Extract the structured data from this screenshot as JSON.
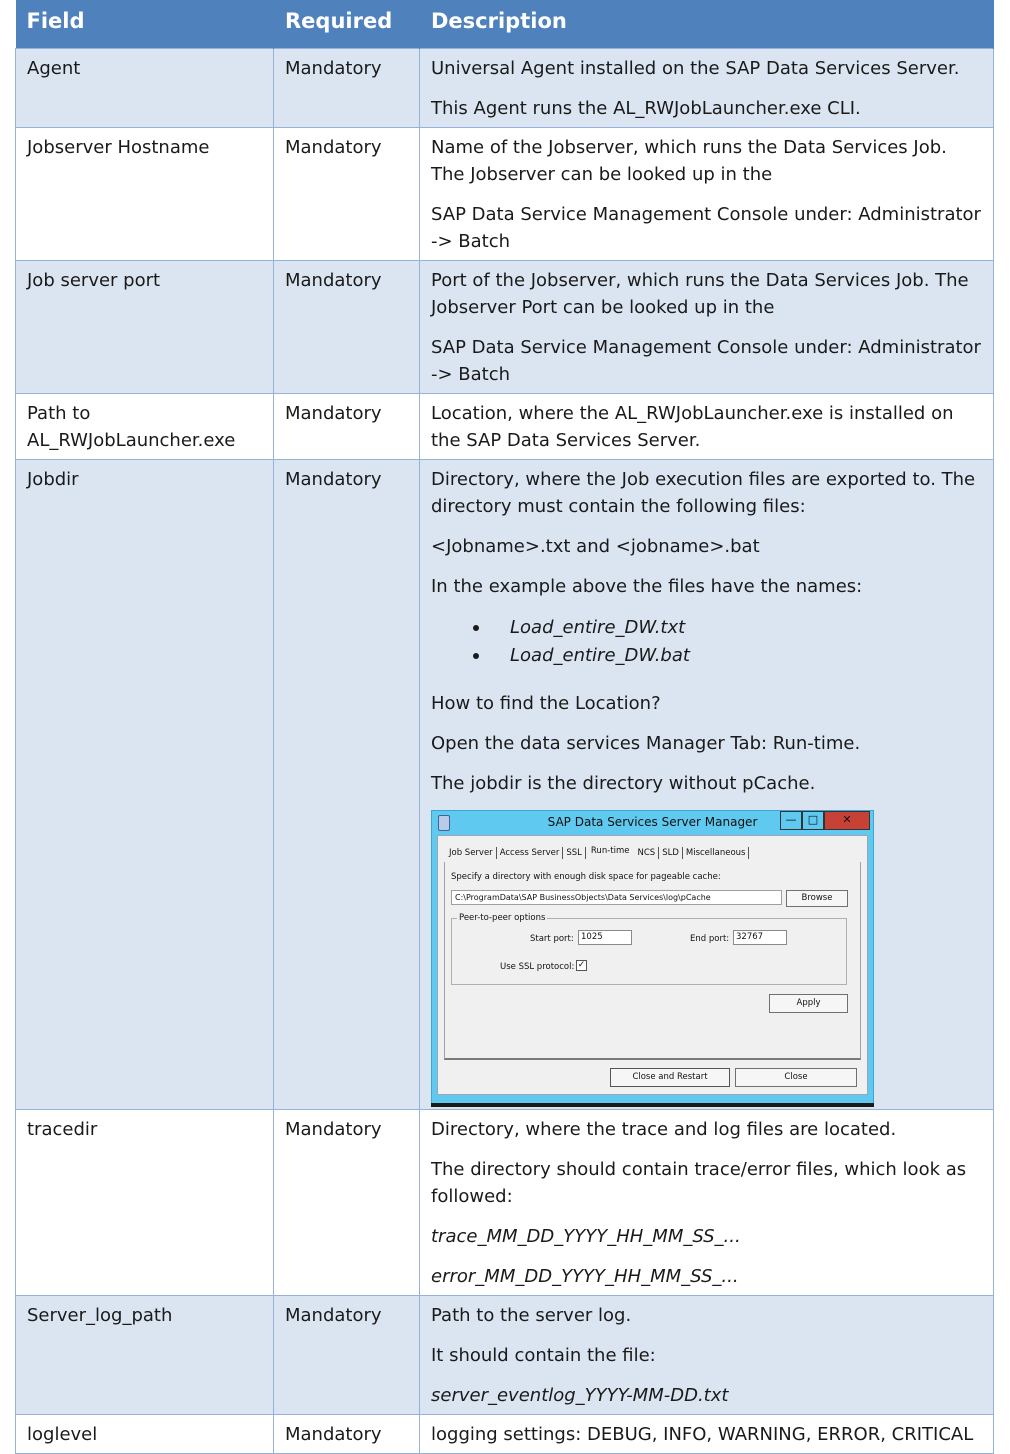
{
  "header": {
    "field": "Field",
    "required": "Required",
    "description": "Description"
  },
  "rows": {
    "agent": {
      "field": "Agent",
      "required": "Mandatory",
      "desc": [
        "Universal Agent installed on the SAP Data Services Server.",
        "This Agent runs the AL_RWJobLauncher.exe CLI."
      ]
    },
    "jobserver_hostname": {
      "field": "Jobserver Hostname",
      "required": "Mandatory",
      "desc": [
        "Name of the Jobserver, which runs the Data Services Job. The Jobserver can be looked up in the",
        "SAP Data Service Management Console under: Administrator -> Batch"
      ]
    },
    "job_server_port": {
      "field": "Job server port",
      "required": "Mandatory",
      "desc": [
        "Port of the Jobserver, which runs the Data Services Job. The Jobserver Port can be looked up in the",
        "SAP Data Service Management Console under: Administrator -> Batch"
      ]
    },
    "path_launcher": {
      "field": "Path to AL_RWJobLauncher.exe",
      "required": "Mandatory",
      "desc": [
        "Location, where the AL_RWJobLauncher.exe is installed on the SAP Data Services Server."
      ]
    },
    "jobdir": {
      "field": "Jobdir",
      "required": "Mandatory",
      "desc": [
        "Directory, where the Job execution files are exported to. The directory must contain the following files:",
        "<Jobname>.txt and <jobname>.bat",
        "In the example above the files have the names:"
      ],
      "bullets": [
        "Load_entire_DW.txt",
        "Load_entire_DW.bat"
      ],
      "desc_after": [
        "How to find the Location?",
        "Open the data services Manager Tab: Run-time.",
        "The jobdir is the directory without pCache."
      ]
    },
    "tracedir": {
      "field": "tracedir",
      "required": "Mandatory",
      "desc": [
        "Directory, where the trace and log files are located.",
        "The directory should contain trace/error files, which look as followed:",
        "trace_MM_DD_YYYY_HH_MM_SS_...",
        "error_MM_DD_YYYY_HH_MM_SS_..."
      ]
    },
    "server_log_path": {
      "field": "Server_log_path",
      "required": "Mandatory",
      "desc": [
        "Path to the server log.",
        "It should contain the file:",
        "server_eventlog_YYYY-MM-DD.txt"
      ]
    },
    "loglevel": {
      "field": "loglevel",
      "required": "Mandatory",
      "desc": [
        "logging settings: DEBUG, INFO, WARNING, ERROR, CRITICAL"
      ]
    }
  },
  "dialog": {
    "title": "SAP Data Services Server Manager",
    "window_buttons": {
      "minimize": "—",
      "maximize": "□",
      "close": "✕"
    },
    "tabs": [
      "Job Server",
      "Access Server",
      "SSL",
      "Run-time",
      "NCS",
      "SLD",
      "Miscellaneous"
    ],
    "active_tab": "Run-time",
    "cache_label": "Specify a directory with enough disk space for pageable cache:",
    "cache_path": "C:\\ProgramData\\SAP BusinessObjects\\Data Services\\log\\pCache",
    "browse_label": "Browse",
    "group_label": "Peer-to-peer options",
    "start_port_label": "Start port:",
    "start_port_value": "1025",
    "end_port_label": "End port:",
    "end_port_value": "32767",
    "ssl_label": "Use SSL protocol:",
    "ssl_checked": "✓",
    "apply_label": "Apply",
    "close_restart_label": "Close and Restart",
    "close_label": "Close"
  }
}
